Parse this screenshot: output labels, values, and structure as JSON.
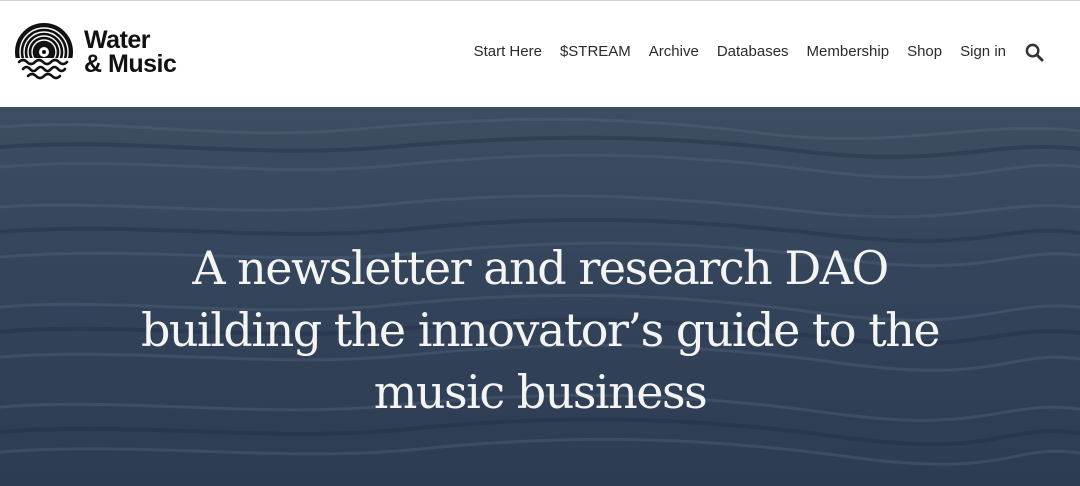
{
  "brand": {
    "line1": "Water",
    "line2": "& Music",
    "logo_icon": "vinyl-record-waves-icon"
  },
  "nav": {
    "items": [
      {
        "label": "Start Here"
      },
      {
        "label": "$STREAM"
      },
      {
        "label": "Archive"
      },
      {
        "label": "Databases"
      },
      {
        "label": "Membership"
      },
      {
        "label": "Shop"
      },
      {
        "label": "Sign in"
      }
    ],
    "search_icon": "search-icon"
  },
  "hero": {
    "title": "A newsletter and research DAO building the innovator’s guide to the music business",
    "background": "dark ocean water texture"
  },
  "colors": {
    "hero_bg": "#34445a",
    "hero_text": "#f4f4f2",
    "nav_text": "#2b2b2b",
    "brand_text": "#111111"
  }
}
